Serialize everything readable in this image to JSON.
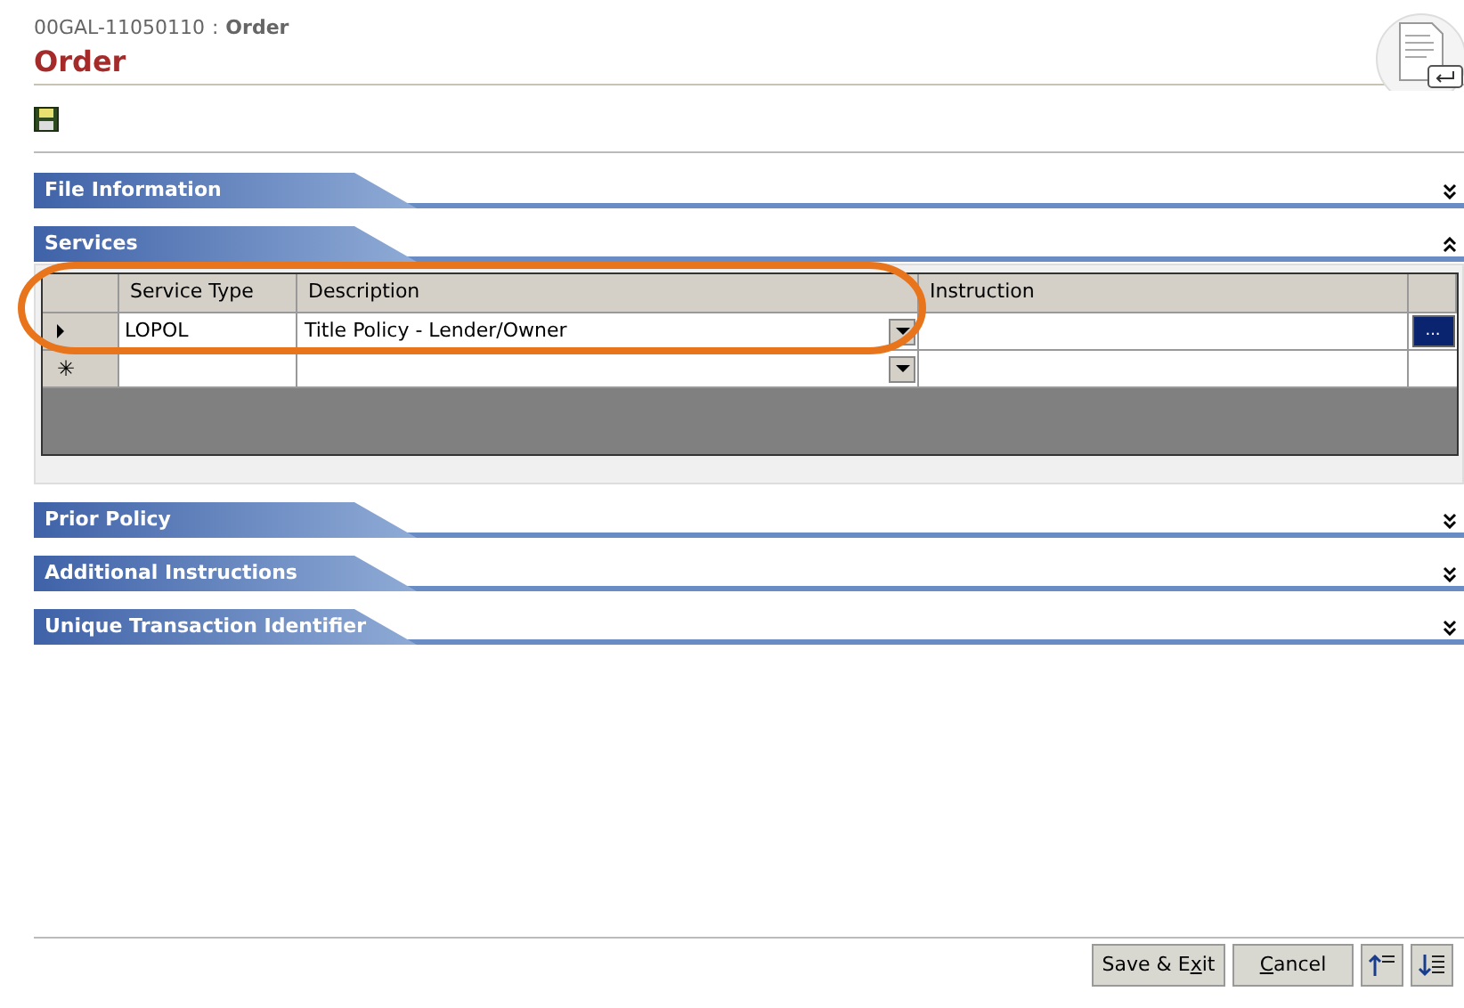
{
  "header": {
    "file_number": "00GAL-11050110",
    "separator": ":",
    "breadcrumb": "Order",
    "title": "Order"
  },
  "sections": [
    {
      "title": "File Information",
      "expanded": false
    },
    {
      "title": "Services",
      "expanded": true,
      "grid": {
        "columns": [
          "Service Type",
          "Description",
          "Instruction"
        ],
        "rows": [
          {
            "kind": "current",
            "service_type": "LOPOL",
            "description": "Title Policy - Lender/Owner",
            "instruction": ""
          },
          {
            "kind": "new",
            "service_type": "",
            "description": "",
            "instruction": ""
          }
        ]
      }
    },
    {
      "title": "Prior Policy",
      "expanded": false
    },
    {
      "title": "Additional Instructions",
      "expanded": false
    },
    {
      "title": "Unique Transaction Identifier",
      "expanded": false
    }
  ],
  "row_button": "...",
  "new_row_marker": "✳",
  "footer_buttons": [
    {
      "before": "Save & E",
      "mnemonic": "x",
      "after": "it"
    },
    {
      "mnemonic": "C",
      "after": "ancel"
    }
  ]
}
